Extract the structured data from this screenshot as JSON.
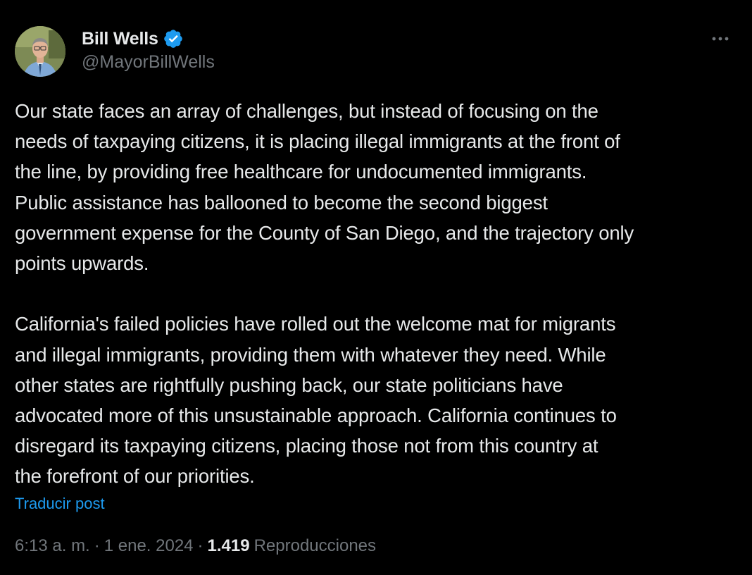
{
  "author": {
    "display_name": "Bill Wells",
    "handle": "@MayorBillWells",
    "verified_icon": "verified-badge-icon",
    "verified_color": "#1d9bf0"
  },
  "post": {
    "text": "Our state faces an array of challenges, but instead of focusing on the\nneeds of taxpaying citizens, it is placing illegal immigrants at the front of\nthe line, by providing free healthcare for undocumented immigrants.\nPublic assistance has ballooned to become the second biggest\ngovernment expense for the County of San Diego, and the trajectory only\npoints upwards.\n\nCalifornia's failed policies have rolled out the welcome mat for migrants\nand illegal immigrants, providing them with whatever they need. While\nother states are rightfully pushing back, our state politicians have\nadvocated more of this unsustainable approach. California continues to\ndisregard its taxpaying citizens, placing those not from this country at\nthe forefront of our priorities.",
    "translate_label": "Traducir post",
    "time": "6:13 a. m.",
    "separator": "·",
    "date": "1 ene. 2024",
    "views_count": "1.419",
    "views_label": "Reproducciones"
  },
  "icons": {
    "more": "more-dots-icon",
    "avatar": "avatar-photo"
  },
  "colors": {
    "background": "#000000",
    "primary_text": "#e7e9ea",
    "secondary_text": "#71767b",
    "link": "#1d9bf0"
  }
}
